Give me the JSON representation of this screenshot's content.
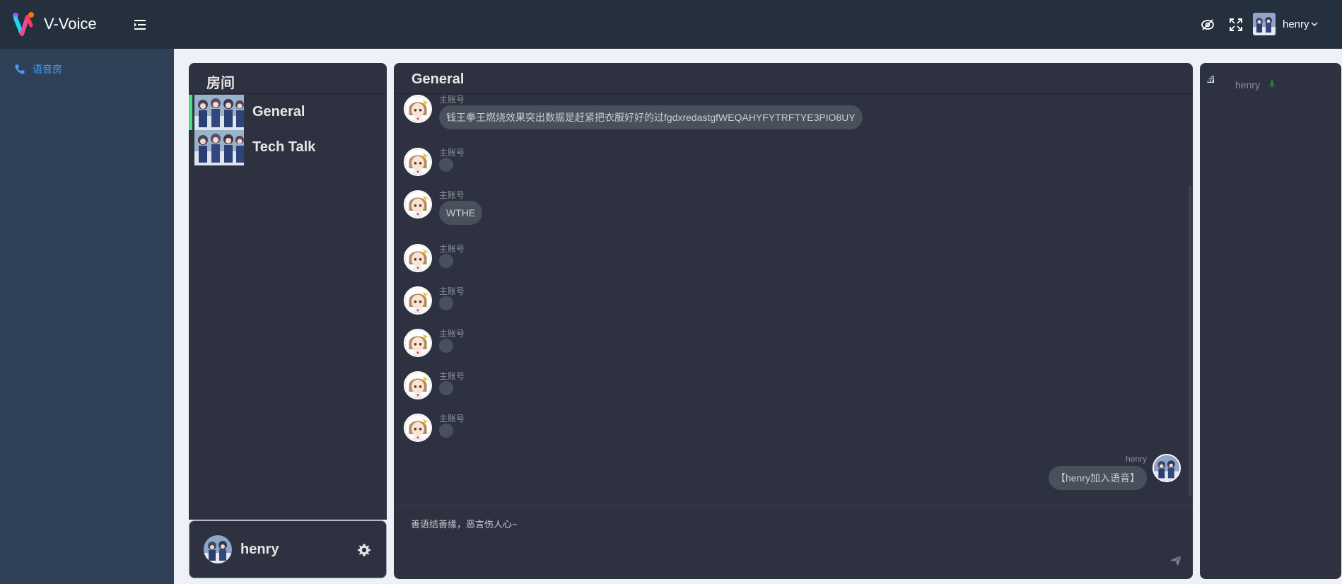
{
  "header": {
    "app_title": "V-Voice",
    "user_name": "henry",
    "icons": [
      "logo-icon",
      "menu-fold-icon",
      "eye-off-icon",
      "fullscreen-icon",
      "chevron-down-icon"
    ]
  },
  "sidebar": {
    "items": [
      {
        "label": "语音房",
        "icon": "phone-icon"
      }
    ]
  },
  "rooms_panel": {
    "title": "房间",
    "rooms": [
      {
        "name": "General",
        "active": true
      },
      {
        "name": "Tech Talk",
        "active": false
      }
    ],
    "current_user": "henry"
  },
  "chat": {
    "title": "General",
    "messages": [
      {
        "sender": "主账号",
        "text": "钱王拳王燃烧效果突出数据是赶紧把衣服好好的过fgdxredastgfWEQAHYFYTRFTYE3PIO8UY"
      },
      {
        "sender": "主账号",
        "text": ""
      },
      {
        "sender": "主账号",
        "text": "WTHE"
      },
      {
        "sender": "主账号",
        "text": ""
      },
      {
        "sender": "主账号",
        "text": ""
      },
      {
        "sender": "主账号",
        "text": ""
      },
      {
        "sender": "主账号",
        "text": ""
      },
      {
        "sender": "主账号",
        "text": ""
      }
    ],
    "my_message": {
      "sender": "henry",
      "text": "【henry加入语音】"
    },
    "composer_placeholder": "善语结善缘，恶言伤人心~"
  },
  "members": [
    {
      "name": "henry",
      "status_icon": "microphone-icon",
      "status_color": "#2e7d32"
    }
  ],
  "colors": {
    "topbar": "#25303f",
    "sidebar": "#304056",
    "panel": "#2e3240",
    "accent": "#409eff",
    "active_room": "#4ade80"
  }
}
